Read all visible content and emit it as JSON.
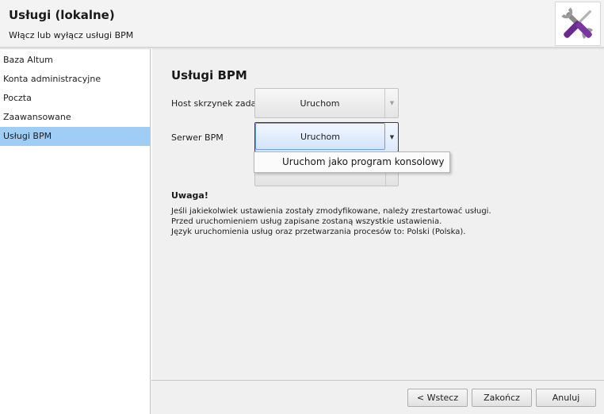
{
  "header": {
    "title": "Usługi (lokalne)",
    "subtitle": "Włącz lub wyłącz usługi BPM",
    "logo_icon": "tools-icon"
  },
  "sidebar": {
    "items": [
      {
        "label": "Baza Altum"
      },
      {
        "label": "Konta administracyjne"
      },
      {
        "label": "Poczta"
      },
      {
        "label": "Zaawansowane"
      },
      {
        "label": "Usługi BPM",
        "active": true
      }
    ]
  },
  "main": {
    "title": "Usługi BPM",
    "rows": [
      {
        "label": "Host skrzynek zadań",
        "button": "Uruchom"
      },
      {
        "label": "Serwer BPM",
        "button": "Uruchom"
      }
    ],
    "dropdown": {
      "items": [
        "Uruchom jako program konsolowy"
      ]
    },
    "note": {
      "title": "Uwaga!",
      "lines": [
        "Jeśli jakiekolwiek ustawienia zostały zmodyfikowane, należy zrestartować usługi.",
        "Przed uruchomieniem usług zapisane zostaną wszystkie ustawienia.",
        "Język uruchomienia usług oraz przetwarzania procesów to: Polski (Polska)."
      ]
    }
  },
  "footer": {
    "back": "< Wstecz",
    "finish": "Zakończ",
    "cancel": "Anuluj"
  },
  "colors": {
    "active_item": "#9fcdf5",
    "logo_purple": "#6a2b8e"
  }
}
